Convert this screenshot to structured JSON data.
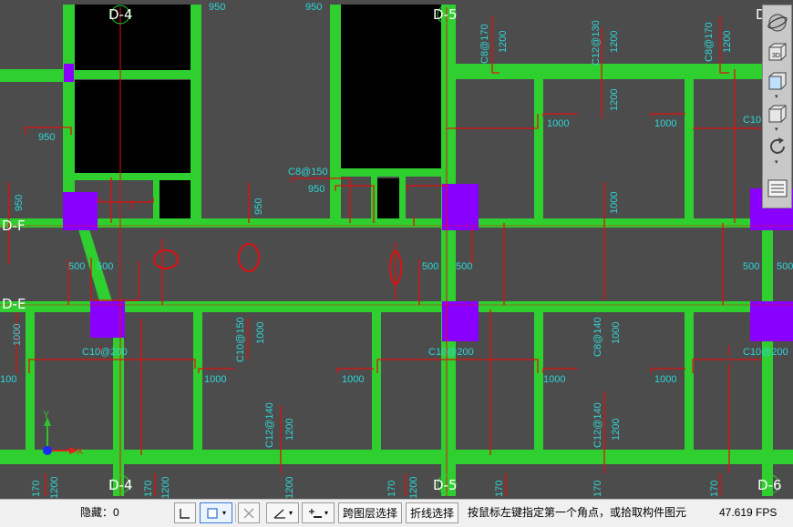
{
  "axes": {
    "d4": "D-4",
    "d5": "D-5",
    "d6": "D-6",
    "df": "D-F",
    "de": "D-E",
    "top_right_partial": "D-"
  },
  "dims": {
    "d950_a": "950",
    "d950_b": "950",
    "d950_c": "950",
    "d950_d": "950",
    "d950_v1": "950",
    "d950_v2": "950",
    "d1200_a": "1200",
    "d1200_b": "1200",
    "d1200_c": "1200",
    "d1200_d": "1200",
    "d1200_e": "1200",
    "d1200_f": "1200",
    "d1200_g": "1200",
    "d1200_h": "1200",
    "d1200_i": "1200",
    "d1200_j": "1200",
    "d1000_a": "1000",
    "d1000_b": "1000",
    "d1000_c": "1000",
    "d1000_d": "1000",
    "d1000_e": "1000",
    "d1000_f": "1000",
    "d1000_g": "1000",
    "d1000_v1": "1000",
    "d1000_v2": "1000",
    "d1000_v3": "1000",
    "d1000_v4": "1000",
    "d1000_v5": "1000",
    "d500_a": "500",
    "d500_b": "500",
    "d500_c": "500",
    "d500_d": "500",
    "d500_e": "500",
    "d500_f": "500",
    "c8_150": "C8@150",
    "c8_170a": "C8@170",
    "c8_170b": "C8@170",
    "c12_130": "C12@130",
    "c10_200a": "C10@200",
    "c10_200b": "C10@200",
    "c10_200c": "C10@200",
    "c10_150": "C10@150",
    "c8_140": "C8@140",
    "c12_140a": "C12@140",
    "c12_140b": "C12@140",
    "c10_100": "C10@",
    "d170_a": "170",
    "d170_b": "170",
    "d170_c": "170",
    "d170_d": "170",
    "d170_e": "170",
    "d170_f": "170",
    "d100_left": "100"
  },
  "ucs": {
    "y": "Y",
    "x": "X"
  },
  "colors": {
    "background": "#4c4c4c",
    "beam": "#2fcf2f",
    "column": "#8a00ff",
    "rebar": "#e01010",
    "dimension_text": "#2fd6d6",
    "opening": "#000000"
  },
  "statusbar": {
    "hidden_label": "隐藏：0",
    "cross_layer_select": "跨图层选择",
    "polyline_select": "折线选择",
    "prompt": "按鼠标左键指定第一个角点，或拾取构件图元",
    "fps": "47.619 FPS"
  },
  "view_toolbar": {
    "icons": [
      "orbit-icon",
      "3d-view-icon",
      "plan-view-icon",
      "box-view-icon",
      "rotate-icon",
      "layer-panel-icon"
    ],
    "cube_label": "3D"
  }
}
